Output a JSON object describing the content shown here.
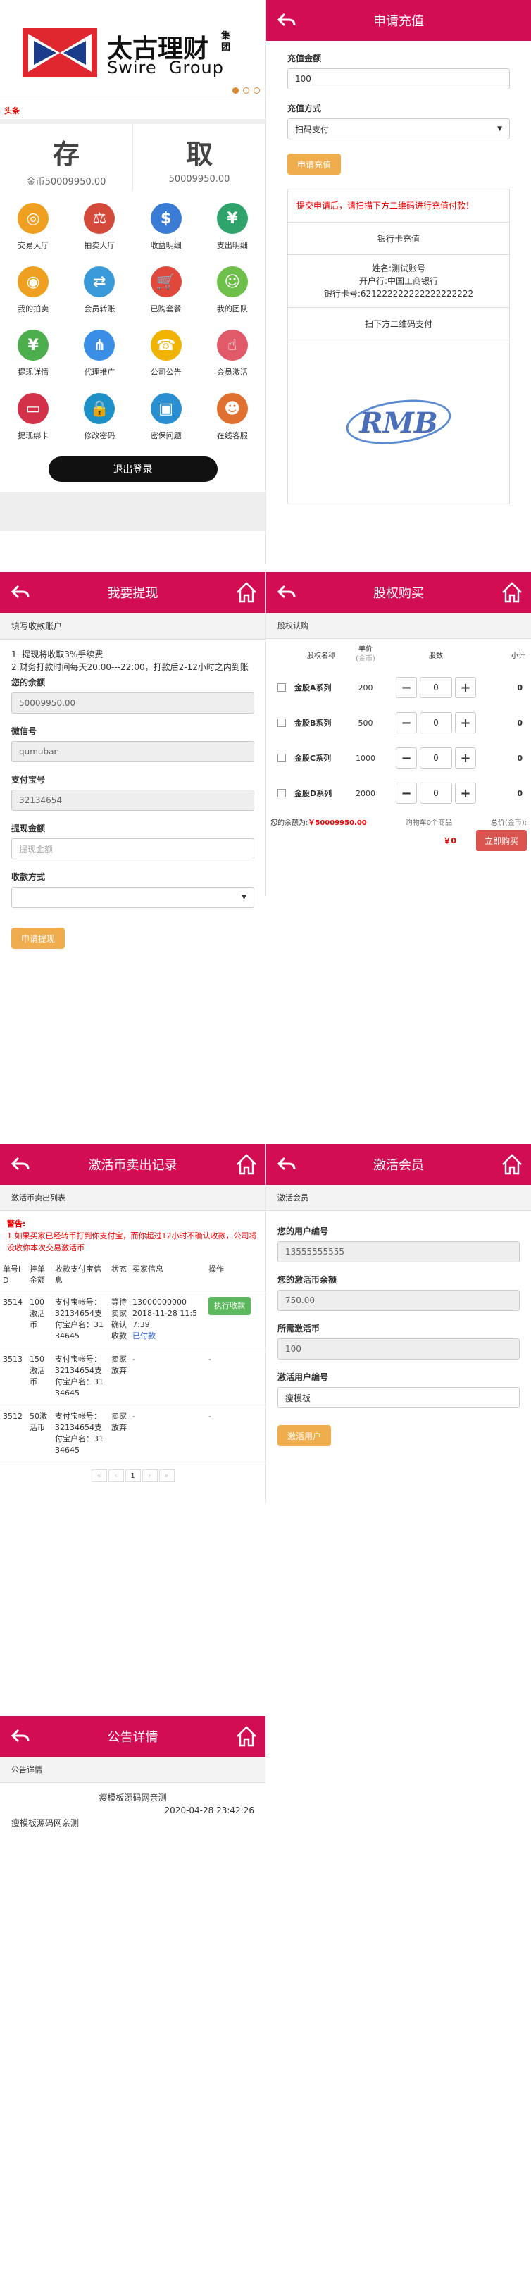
{
  "home": {
    "logo_cn": "太古理财",
    "logo_group_cn": "集团",
    "logo_en": "Swire  Group",
    "headline_tag": "头条",
    "deposit_label": "存",
    "withdraw_label": "取",
    "deposit_value": "金币50009950.00",
    "withdraw_value": "50009950.00",
    "menu": [
      {
        "label": "交易大厅",
        "icon": "trade-hall-icon",
        "color": "#f0a020"
      },
      {
        "label": "拍卖大厅",
        "icon": "auction-hall-icon",
        "color": "#d44a3a"
      },
      {
        "label": "收益明细",
        "icon": "income-detail-icon",
        "color": "#3a7bd5"
      },
      {
        "label": "支出明细",
        "icon": "expense-detail-icon",
        "color": "#2fa36b"
      },
      {
        "label": "我的拍卖",
        "icon": "my-auction-icon",
        "color": "#f0a020"
      },
      {
        "label": "会员转账",
        "icon": "member-transfer-icon",
        "color": "#3a9ad9"
      },
      {
        "label": "已购套餐",
        "icon": "purchased-package-icon",
        "color": "#e0483c"
      },
      {
        "label": "我的团队",
        "icon": "my-team-icon",
        "color": "#6fbf4b"
      },
      {
        "label": "提现详情",
        "icon": "withdraw-detail-icon",
        "color": "#4cae4c"
      },
      {
        "label": "代理推广",
        "icon": "agent-promo-icon",
        "color": "#3a8ee6"
      },
      {
        "label": "公司公告",
        "icon": "company-notice-icon",
        "color": "#f0b400"
      },
      {
        "label": "会员激活",
        "icon": "member-activate-icon",
        "color": "#e05a6a"
      },
      {
        "label": "提现绑卡",
        "icon": "bind-card-icon",
        "color": "#d3304a"
      },
      {
        "label": "修改密码",
        "icon": "change-password-icon",
        "color": "#1e90c8"
      },
      {
        "label": "密保问题",
        "icon": "security-question-icon",
        "color": "#2a8fd0"
      },
      {
        "label": "在线客服",
        "icon": "online-service-icon",
        "color": "#e07030"
      }
    ],
    "logout_label": "退出登录"
  },
  "recharge": {
    "title": "申请充值",
    "amount_label": "充值金额",
    "amount_value": "100",
    "method_label": "充值方式",
    "method_value": "扫码支付",
    "submit_label": "申请充值",
    "notice": "提交申请后，请扫描下方二维码进行充值付款！",
    "bank_title": "银行卡充值",
    "name_line": "姓名:测试账号",
    "bank_line": "开户行:中国工商银行",
    "card_line": "银行卡号:621222222222222222222",
    "qr_title": "扫下方二维码支付",
    "qr_logo": "RMB"
  },
  "withdraw": {
    "title": "我要提现",
    "section": "填写收款账户",
    "rule1": "1. 提现将收取3%手续费",
    "rule2": "2.财务打款时间每天20:00---22:00，打款后2-12小时之内到账",
    "balance_label": "您的余额",
    "balance_value": "50009950.00",
    "wechat_label": "微信号",
    "wechat_value": "qumuban",
    "alipay_label": "支付宝号",
    "alipay_value": "32134654",
    "amount_label": "提现金额",
    "amount_placeholder": "提现金额",
    "method_label": "收款方式",
    "submit_label": "申请提现"
  },
  "equity": {
    "title": "股权购买",
    "section": "股权认购",
    "col_name": "股权名称",
    "col_price": "单价",
    "col_price_unit": "(金币)",
    "col_qty": "股数",
    "col_subtotal": "小计",
    "rows": [
      {
        "name": "金股A系列",
        "price": "200",
        "qty": "0",
        "subtotal": "0"
      },
      {
        "name": "金股B系列",
        "price": "500",
        "qty": "0",
        "subtotal": "0"
      },
      {
        "name": "金股C系列",
        "price": "1000",
        "qty": "0",
        "subtotal": "0"
      },
      {
        "name": "金股D系列",
        "price": "2000",
        "qty": "0",
        "subtotal": "0"
      }
    ],
    "balance_prefix": "您的余额为:",
    "balance_value": "￥50009950.00",
    "cart_text": "购物车0个商品",
    "total_label": "总价(金币):",
    "total_value": "￥0",
    "buy_label": "立即购买"
  },
  "sell": {
    "title": "激活币卖出记录",
    "section": "激活币卖出列表",
    "warning_title": "警告:",
    "warning_text": "1.如果买家已经转币打到你支付宝，而你超过12小时不确认收款，公司将没收你本次交易激活币",
    "headers": [
      "单号ID",
      "挂单金额",
      "收款支付宝信息",
      "状态",
      "买家信息",
      "操作"
    ],
    "rows": [
      {
        "id": "3514",
        "amount": "100激活币",
        "alipay": "支付宝帐号：32134654支付宝户名：3134645",
        "status": "等待卖家确认收款",
        "buyer_phone": "13000000000",
        "buyer_time": "2018-11-28 11:57:39",
        "buyer_paid": "已付款",
        "op": "执行收款"
      },
      {
        "id": "3513",
        "amount": "150激活币",
        "alipay": "支付宝帐号：32134654支付宝户名：3134645",
        "status": "卖家放弃",
        "buyer_phone": "-",
        "buyer_time": "",
        "buyer_paid": "",
        "op": "-"
      },
      {
        "id": "3512",
        "amount": "50激活币",
        "alipay": "支付宝帐号：32134654支付宝户名：3134645",
        "status": "卖家放弃",
        "buyer_phone": "-",
        "buyer_time": "",
        "buyer_paid": "",
        "op": "-"
      }
    ],
    "pager": [
      "«",
      "‹",
      "1",
      "›",
      "»"
    ]
  },
  "activate": {
    "title": "激活会员",
    "section": "激活会员",
    "user_label": "您的用户编号",
    "user_value": "13555555555",
    "balance_label": "您的激活币余额",
    "balance_value": "750.00",
    "need_label": "所需激活币",
    "need_value": "100",
    "target_label": "激活用户编号",
    "target_value": "瘦模板",
    "submit_label": "激活用户"
  },
  "notice": {
    "title": "公告详情",
    "section": "公告详情",
    "headline": "瘦模板源码网亲测",
    "date": "2020-04-28 23:42:26",
    "body": "瘦模板源码网亲测"
  }
}
